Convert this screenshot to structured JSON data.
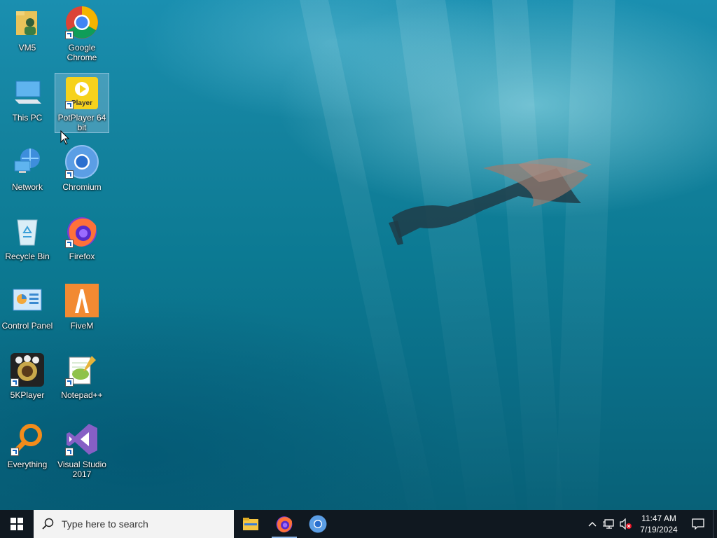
{
  "desktop": {
    "icons": [
      {
        "label": "VM5",
        "icon": "user-folder-icon"
      },
      {
        "label": "Google Chrome",
        "icon": "chrome-icon"
      },
      {
        "label": "This PC",
        "icon": "this-pc-icon"
      },
      {
        "label": "PotPlayer 64 bit",
        "icon": "potplayer-icon",
        "badge": "Player"
      },
      {
        "label": "Network",
        "icon": "network-icon"
      },
      {
        "label": "Chromium",
        "icon": "chromium-icon"
      },
      {
        "label": "Recycle Bin",
        "icon": "recycle-bin-icon"
      },
      {
        "label": "Firefox",
        "icon": "firefox-icon"
      },
      {
        "label": "Control Panel",
        "icon": "control-panel-icon"
      },
      {
        "label": "FiveM",
        "icon": "fivem-icon"
      },
      {
        "label": "5KPlayer",
        "icon": "5kplayer-icon"
      },
      {
        "label": "Notepad++",
        "icon": "notepad-plus-plus-icon"
      },
      {
        "label": "Everything",
        "icon": "everything-search-icon"
      },
      {
        "label": "Visual Studio 2017",
        "icon": "visual-studio-icon"
      }
    ]
  },
  "taskbar": {
    "search_placeholder": "Type here to search",
    "apps": [
      {
        "icon": "file-explorer-icon"
      },
      {
        "icon": "firefox-icon",
        "active": true
      },
      {
        "icon": "chromium-icon"
      }
    ],
    "clock": {
      "time": "11:47 AM",
      "date": "7/19/2024"
    }
  },
  "colors": {
    "taskbar": "#101820",
    "selection": "#b4d2eb"
  }
}
